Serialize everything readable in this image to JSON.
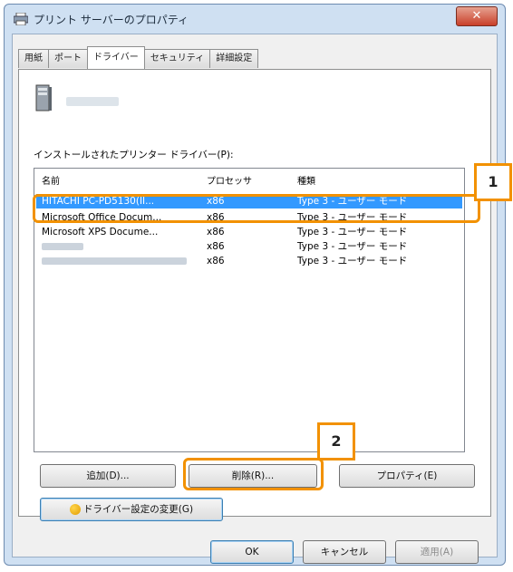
{
  "window": {
    "title": "プリント サーバーのプロパティ",
    "close_glyph": "✕"
  },
  "tabs": [
    {
      "label": "用紙",
      "active": false
    },
    {
      "label": "ポート",
      "active": false
    },
    {
      "label": "ドライバー",
      "active": true
    },
    {
      "label": "セキュリティ",
      "active": false
    },
    {
      "label": "詳細設定",
      "active": false
    }
  ],
  "driver_list_label": "インストールされたプリンター ドライバー(P):",
  "columns": {
    "name": "名前",
    "processor": "プロセッサ",
    "type": "種類"
  },
  "drivers": [
    {
      "name": "HITACHI PC-PD5130(II...",
      "processor": "x86",
      "type": "Type 3 - ユーザー モード",
      "selected": true
    },
    {
      "name": "Microsoft Office Docum...",
      "processor": "x86",
      "type": "Type 3 - ユーザー モード",
      "selected": false
    },
    {
      "name": "Microsoft XPS Docume...",
      "processor": "x86",
      "type": "Type 3 - ユーザー モード",
      "selected": false
    },
    {
      "name": "",
      "processor": "x86",
      "type": "Type 3 - ユーザー モード",
      "selected": false
    },
    {
      "name": "",
      "processor": "x86",
      "type": "Type 3 - ユーザー モード",
      "selected": false
    }
  ],
  "buttons": {
    "add": "追加(D)...",
    "remove": "削除(R)...",
    "properties": "プロパティ(E)",
    "change_settings": "ドライバー設定の変更(G)",
    "ok": "OK",
    "cancel": "キャンセル",
    "apply": "適用(A)"
  },
  "callouts": {
    "one": "1",
    "two": "2"
  },
  "colors": {
    "highlight": "#f29100",
    "selection": "#3399ff"
  }
}
